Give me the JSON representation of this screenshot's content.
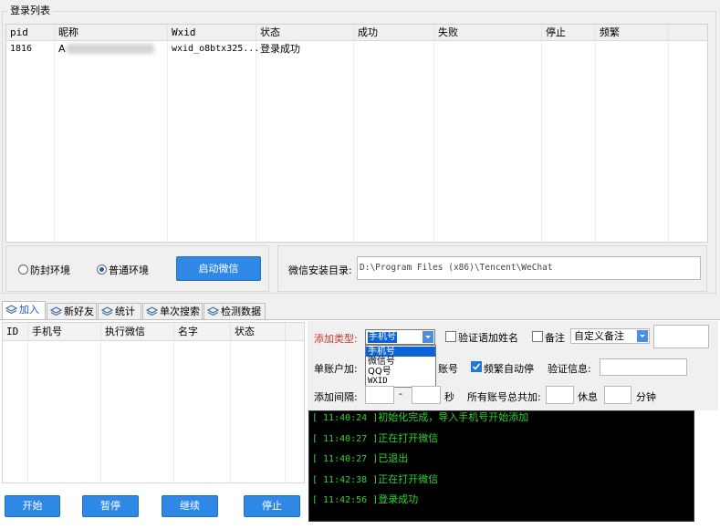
{
  "login_list": {
    "title": "登录列表",
    "columns": [
      "pid",
      "昵称",
      "Wxid",
      "状态",
      "成功",
      "失败",
      "停止",
      "频繁"
    ],
    "rows": [
      {
        "pid": "1816",
        "nickname": "A",
        "wxid": "wxid_o8btx325...",
        "status": "登录成功",
        "success": "",
        "fail": "",
        "stop": "",
        "frequent": ""
      }
    ]
  },
  "environment": {
    "option_anti_ban": "防封环境",
    "option_normal": "普通环境",
    "selected": "普通环境",
    "launch_button": "启动微信"
  },
  "install_dir": {
    "label": "微信安装目录:",
    "value": "D:\\Program Files (x86)\\Tencent\\WeChat"
  },
  "tabs": [
    {
      "label": "加入",
      "active": true
    },
    {
      "label": "新好友",
      "active": false
    },
    {
      "label": "统计",
      "active": false
    },
    {
      "label": "单次搜索",
      "active": false
    },
    {
      "label": "检测数据",
      "active": false
    }
  ],
  "add_table": {
    "columns": [
      "ID",
      "手机号",
      "执行微信",
      "名字",
      "状态"
    ]
  },
  "settings": {
    "add_type_label": "添加类型:",
    "add_type_value": "手机号",
    "add_type_options": [
      "手机号",
      "微信号",
      "QQ号",
      "WXID"
    ],
    "verify_add_name": "验证语加姓名",
    "verify_add_name_checked": false,
    "remark": "备注",
    "remark_checked": false,
    "remark_type_value": "自定义备注",
    "single_account_add_label": "单账户加:",
    "account_suffix": "账号",
    "frequent_auto_stop": "频繁自动停",
    "frequent_auto_stop_checked": true,
    "verify_info_label": "验证信息:",
    "interval_label": "添加间隔:",
    "interval_dash": "-",
    "seconds_unit": "秒",
    "all_accounts_total_label": "所有账号总共加:",
    "rest_label": "休息",
    "minutes_unit": "分钟"
  },
  "log": [
    {
      "time": "[ 11:40:24 ]",
      "message": "初始化完成，导入手机号开始添加"
    },
    {
      "time": "[ 11:40:27 ]",
      "message": "正在打开微信"
    },
    {
      "time": "[ 11:40:27 ]",
      "message": "已退出"
    },
    {
      "time": "[ 11:42:38 ]",
      "message": "正在打开微信"
    },
    {
      "time": "[ 11:42:56 ]",
      "message": "登录成功"
    }
  ],
  "buttons": {
    "start": "开始",
    "pause": "暂停",
    "continue": "继续",
    "stop": "停止"
  },
  "colors": {
    "accent_blue": "#2f88e6",
    "log_green": "#31d431",
    "label_red": "#c0392b",
    "selection_blue": "#0a64d6"
  }
}
